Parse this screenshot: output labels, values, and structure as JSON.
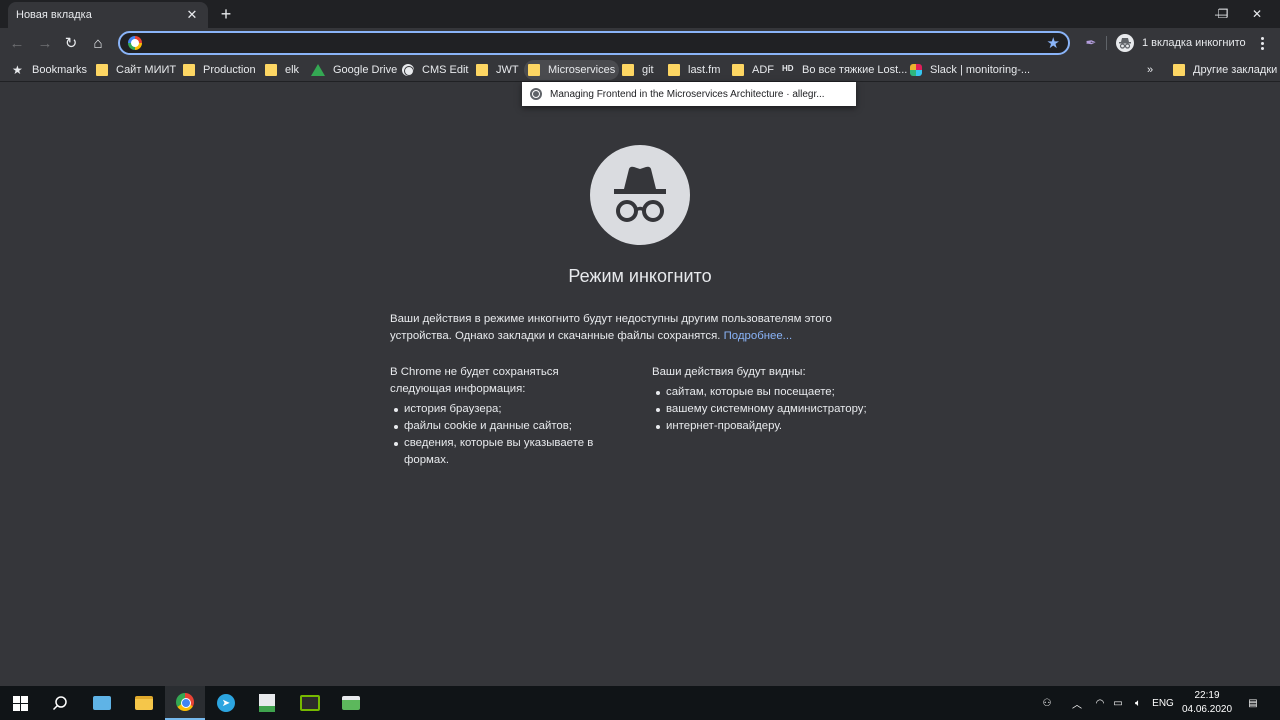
{
  "window": {
    "tab_title": "Новая вкладка",
    "new_tab": "+",
    "minimize": "—",
    "restore": "❐",
    "close": "✕"
  },
  "toolbar": {
    "omnibox_value": "",
    "incognito_label": "1 вкладка инкогнито"
  },
  "bookmarks": {
    "items": [
      {
        "label": "Bookmarks",
        "icon": "star-icon"
      },
      {
        "label": "Сайт МИИТ",
        "icon": "folder-icon"
      },
      {
        "label": "Production",
        "icon": "folder-icon"
      },
      {
        "label": "elk",
        "icon": "folder-icon"
      },
      {
        "label": "Google Drive",
        "icon": "drive-icon"
      },
      {
        "label": "CMS Edit",
        "icon": "globe-icon"
      },
      {
        "label": "JWT",
        "icon": "folder-icon"
      },
      {
        "label": "Microservices",
        "icon": "folder-icon"
      },
      {
        "label": "git",
        "icon": "folder-icon"
      },
      {
        "label": "last.fm",
        "icon": "folder-icon"
      },
      {
        "label": "ADF",
        "icon": "folder-icon"
      },
      {
        "label": "Во все тяжкие Lost...",
        "icon": "hd-icon"
      },
      {
        "label": "Slack | monitoring-...",
        "icon": "slack-icon"
      }
    ],
    "overflow": "»",
    "other": "Другие закладки",
    "hd_text": "HD"
  },
  "dropdown": {
    "item": "Managing Frontend in the Microservices Architecture · allegr..."
  },
  "incognito": {
    "title": "Режим инкогнито",
    "intro": "Ваши действия в режиме инкогнито будут недоступны другим пользователям этого устройства. Однако закладки и скачанные файлы сохранятся.",
    "learn_more": "Подробнее...",
    "left_heading_line1": "В Chrome не будет сохраняться",
    "left_heading_line2": "следующая информация:",
    "left_items": [
      "история браузера;",
      "файлы cookie и данные сайтов;",
      "сведения, которые вы указываете в формах."
    ],
    "right_heading": "Ваши действия будут видны:",
    "right_items": [
      "сайтам, которые вы посещаете;",
      "вашему системному администратору;",
      "интернет-провайдеру."
    ]
  },
  "taskbar": {
    "lang": "ENG",
    "time": "22:19",
    "date": "04.06.2020"
  }
}
